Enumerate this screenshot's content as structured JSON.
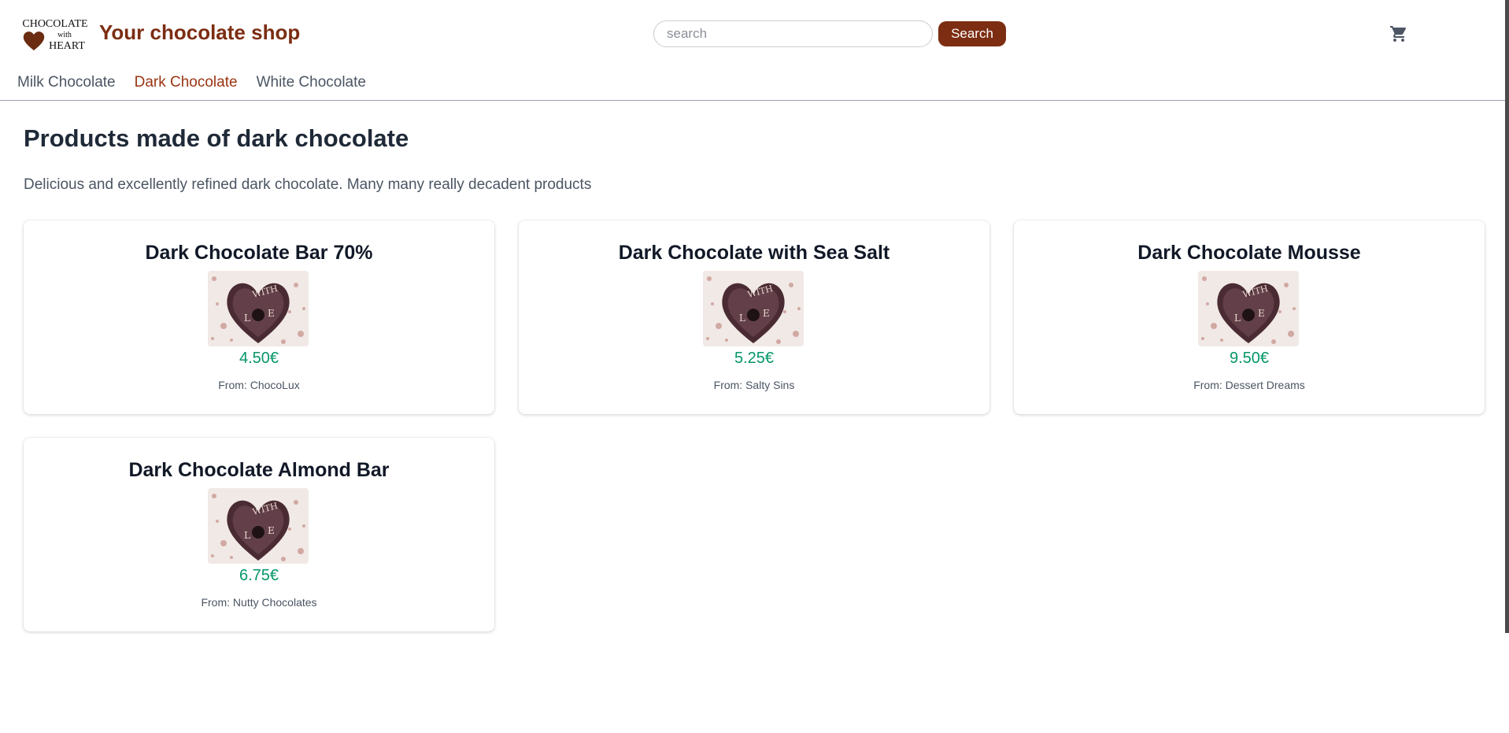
{
  "header": {
    "logo_text": [
      "CHOCOLATE",
      "with",
      "HEART"
    ],
    "shop_title": "Your chocolate shop",
    "search": {
      "placeholder": "search",
      "value": "",
      "button_label": "Search"
    },
    "cart_icon": "shopping-cart-icon"
  },
  "nav": {
    "items": [
      {
        "label": "Milk Chocolate",
        "active": false
      },
      {
        "label": "Dark Chocolate",
        "active": true
      },
      {
        "label": "White Chocolate",
        "active": false
      }
    ]
  },
  "main": {
    "title": "Products made of dark chocolate",
    "description": "Delicious and excellently refined dark chocolate. Many many really decadent products",
    "products": [
      {
        "name": "Dark Chocolate Bar 70%",
        "price": "4.50€",
        "from_label": "From: ",
        "vendor": "ChocoLux",
        "image": "heart-chocolate-with-love"
      },
      {
        "name": "Dark Chocolate with Sea Salt",
        "price": "5.25€",
        "from_label": "From: ",
        "vendor": "Salty Sins",
        "image": "heart-chocolate-with-love"
      },
      {
        "name": "Dark Chocolate Mousse",
        "price": "9.50€",
        "from_label": "From: ",
        "vendor": "Dessert Dreams",
        "image": "heart-chocolate-with-love"
      },
      {
        "name": "Dark Chocolate Almond Bar",
        "price": "6.75€",
        "from_label": "From: ",
        "vendor": "Nutty Chocolates",
        "image": "heart-chocolate-with-love"
      }
    ]
  },
  "colors": {
    "brand": "#7c2d12",
    "active_nav": "#9a3412",
    "price": "#059669"
  }
}
